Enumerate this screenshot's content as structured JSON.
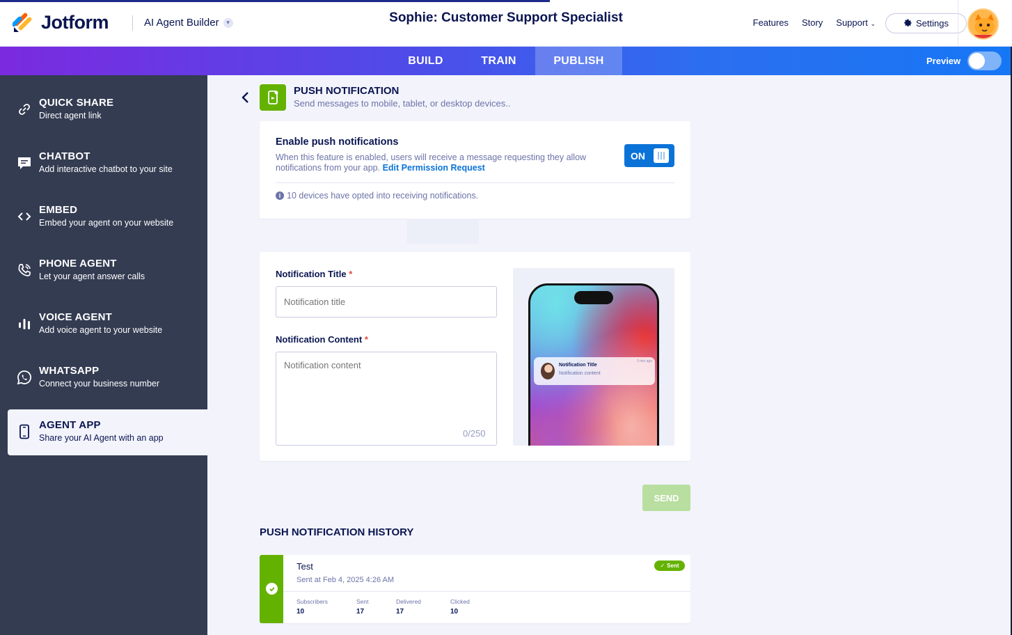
{
  "header": {
    "brand": "Jotform",
    "product": "AI Agent Builder",
    "agent_title": "Sophie: Customer Support Specialist",
    "nav": [
      "Features",
      "Story",
      "Support"
    ],
    "settings_label": "Settings"
  },
  "tabs": {
    "items": [
      "BUILD",
      "TRAIN",
      "PUBLISH"
    ],
    "active": "PUBLISH",
    "preview_label": "Preview",
    "preview_on": false
  },
  "sidebar": {
    "items": [
      {
        "title": "QUICK SHARE",
        "desc": "Direct agent link",
        "icon": "link-icon"
      },
      {
        "title": "CHATBOT",
        "desc": "Add interactive chatbot to your site",
        "icon": "chat-bubble-icon"
      },
      {
        "title": "EMBED",
        "desc": "Embed your agent on your website",
        "icon": "code-brackets-icon"
      },
      {
        "title": "PHONE AGENT",
        "desc": "Let your agent answer calls",
        "icon": "phone-icon"
      },
      {
        "title": "VOICE AGENT",
        "desc": "Add voice agent to your website",
        "icon": "voice-bars-icon"
      },
      {
        "title": "WHATSAPP",
        "desc": "Connect your business number",
        "icon": "whatsapp-icon"
      },
      {
        "title": "AGENT APP",
        "desc": "Share your AI Agent with an app",
        "icon": "mobile-app-icon"
      }
    ],
    "active": "AGENT APP"
  },
  "push": {
    "title": "PUSH NOTIFICATION",
    "subtitle": "Send messages to mobile, tablet, or desktop devices..",
    "enable_title": "Enable push notifications",
    "enable_desc": "When this feature is enabled, users will receive a message requesting they allow notifications from your app.",
    "enable_link": "Edit Permission Request",
    "toggle_label": "ON",
    "optin_text": "10 devices have opted into receiving notifications."
  },
  "form": {
    "title_label": "Notification Title",
    "title_placeholder": "Notification title",
    "content_label": "Notification Content",
    "content_placeholder": "Notification content",
    "counter": "0/250",
    "required_mark": "*",
    "send_label": "SEND"
  },
  "preview_notification": {
    "title": "Notification Title",
    "content": "Notification content",
    "time": "3 min ago"
  },
  "history": {
    "title": "PUSH NOTIFICATION HISTORY",
    "items": [
      {
        "name": "Test",
        "date": "Sent at Feb 4, 2025 4:26 AM",
        "status": "Sent",
        "stats": [
          {
            "label": "Subscribers",
            "value": "10"
          },
          {
            "label": "Sent",
            "value": "17"
          },
          {
            "label": "Delivered",
            "value": "17"
          },
          {
            "label": "Clicked",
            "value": "10"
          }
        ]
      }
    ]
  },
  "colors": {
    "brand_navy": "#0a1551",
    "accent_blue": "#0b73d8",
    "success_green": "#64b200",
    "sidebar_bg": "#343c52"
  }
}
